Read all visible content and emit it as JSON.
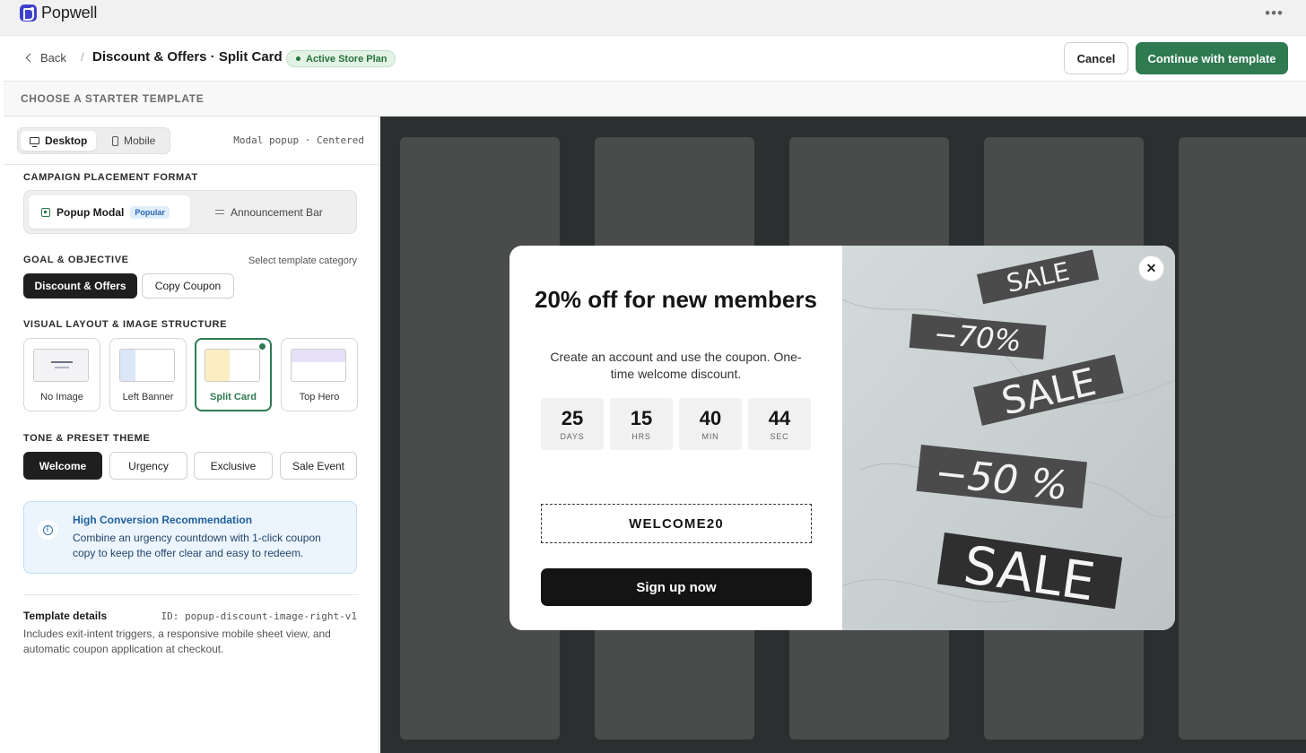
{
  "app": {
    "name": "Popwell",
    "more_icon": "more-horizontal-icon"
  },
  "header": {
    "back_label": "Back",
    "separator": "/",
    "title": "Discount & Offers · Split Card",
    "plan_badge": "Active Store Plan",
    "cancel_label": "Cancel",
    "continue_label": "Continue with template"
  },
  "section_label": "CHOOSE A STARTER TEMPLATE",
  "panel": {
    "device": {
      "desktop": "Desktop",
      "mobile": "Mobile",
      "active": "Desktop",
      "mode": "Modal popup · Centered"
    },
    "placement": {
      "title": "CAMPAIGN PLACEMENT FORMAT",
      "options": [
        {
          "label": "Popup Modal",
          "badge": "Popular",
          "icon": "popup-icon",
          "active": true
        },
        {
          "label": "Announcement Bar",
          "icon": "bar-icon",
          "active": false
        }
      ]
    },
    "goal": {
      "title": "GOAL & OBJECTIVE",
      "hint": "Select template category",
      "options": [
        "Discount & Offers",
        "Copy Coupon"
      ],
      "selected": "Discount & Offers"
    },
    "layout": {
      "title": "VISUAL LAYOUT & IMAGE STRUCTURE",
      "options": [
        "No Image",
        "Left Banner",
        "Split Card",
        "Top Hero"
      ],
      "selected": "Split Card"
    },
    "tone": {
      "title": "TONE & PRESET THEME",
      "options": [
        "Welcome",
        "Urgency",
        "Exclusive",
        "Sale Event"
      ],
      "selected": "Welcome"
    },
    "recommendation": {
      "title": "High Conversion Recommendation",
      "text": "Combine an urgency countdown with 1-click coupon copy to keep the offer clear and easy to redeem."
    },
    "details": {
      "title": "Template details",
      "id": "ID: popup-discount-image-right-v1",
      "text": "Includes exit-intent triggers, a responsive mobile sheet view, and automatic coupon application at checkout."
    }
  },
  "popup": {
    "headline": "20% off for new members",
    "subtext": "Create an account and use the coupon. One-time welcome discount.",
    "countdown": [
      {
        "value": "25",
        "unit": "DAYS"
      },
      {
        "value": "15",
        "unit": "HRS"
      },
      {
        "value": "40",
        "unit": "MIN"
      },
      {
        "value": "44",
        "unit": "SEC"
      }
    ],
    "coupon_code": "WELCOME20",
    "cta": "Sign up now",
    "close_icon": "close-icon",
    "image_tags": [
      "SALE",
      "−70%",
      "SALE",
      "−50 %",
      "SALE"
    ]
  },
  "colors": {
    "accent": "#2f7a51",
    "dark": "#1f1f1f",
    "preview_bg": "#2c2f2f",
    "info": "#1f5f9c"
  }
}
